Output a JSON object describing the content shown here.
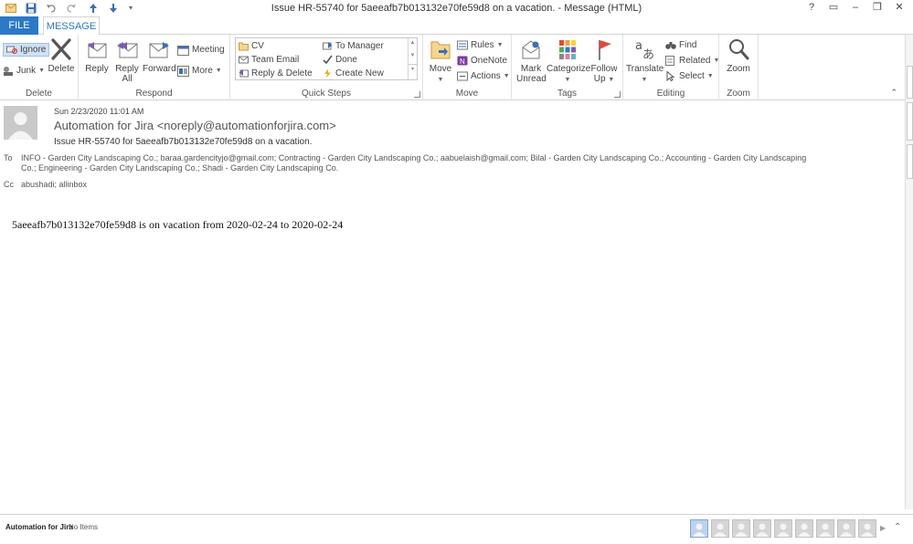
{
  "window": {
    "title": "Issue HR-55740 for 5aeeafb7b013132e70fe59d8 on a vacation. - Message (HTML)",
    "controls": [
      "?",
      "▭",
      "–",
      "❐",
      "✕"
    ]
  },
  "tabs": {
    "file": "FILE",
    "message": "MESSAGE"
  },
  "ribbon": {
    "delete": {
      "label": "Delete",
      "ignore": "Ignore",
      "junk": "Junk",
      "delete_btn": "Delete"
    },
    "respond": {
      "label": "Respond",
      "reply": "Reply",
      "reply_all_1": "Reply",
      "reply_all_2": "All",
      "forward": "Forward",
      "meeting": "Meeting",
      "more": "More"
    },
    "quick_steps": {
      "label": "Quick Steps",
      "cv": "CV",
      "team_email": "Team Email",
      "reply_delete": "Reply & Delete",
      "to_manager": "To Manager",
      "done": "Done",
      "create_new": "Create New"
    },
    "move": {
      "label": "Move",
      "move_btn": "Move",
      "rules": "Rules",
      "onenote": "OneNote",
      "actions": "Actions"
    },
    "tags": {
      "label": "Tags",
      "mark_unread_1": "Mark",
      "mark_unread_2": "Unread",
      "categorize": "Categorize",
      "follow_up_1": "Follow",
      "follow_up_2": "Up"
    },
    "editing": {
      "label": "Editing",
      "translate": "Translate",
      "find": "Find",
      "related": "Related",
      "select": "Select"
    },
    "zoom": {
      "label": "Zoom",
      "zoom_btn": "Zoom"
    }
  },
  "message": {
    "date": "Sun 2/23/2020 11:01 AM",
    "sender": "Automation for Jira <noreply@automationforjira.com>",
    "subject": "Issue HR-55740 for 5aeeafb7b013132e70fe59d8 on a vacation.",
    "to_label": "To",
    "to": "INFO - Garden City Landscaping Co.; baraa.gardencityjo@gmail.com; Contracting - Garden City Landscaping Co.; aabuelaish@gmail.com; Bilal - Garden City Landscaping Co.; Accounting -  Garden City Landscaping Co.; Engineering - Garden City Landscaping Co.; Shadi - Garden City Landscaping Co.",
    "cc_label": "Cc",
    "cc": "abushadi; allinbox",
    "body": "5aeeafb7b013132e70fe59d8 is on vacation from 2020-02-24 to 2020-02-24"
  },
  "footer": {
    "name": "Automation for Jira",
    "items": "No Items"
  },
  "colors": {
    "accent": "#2b79c7",
    "flag": "#e2483c"
  }
}
